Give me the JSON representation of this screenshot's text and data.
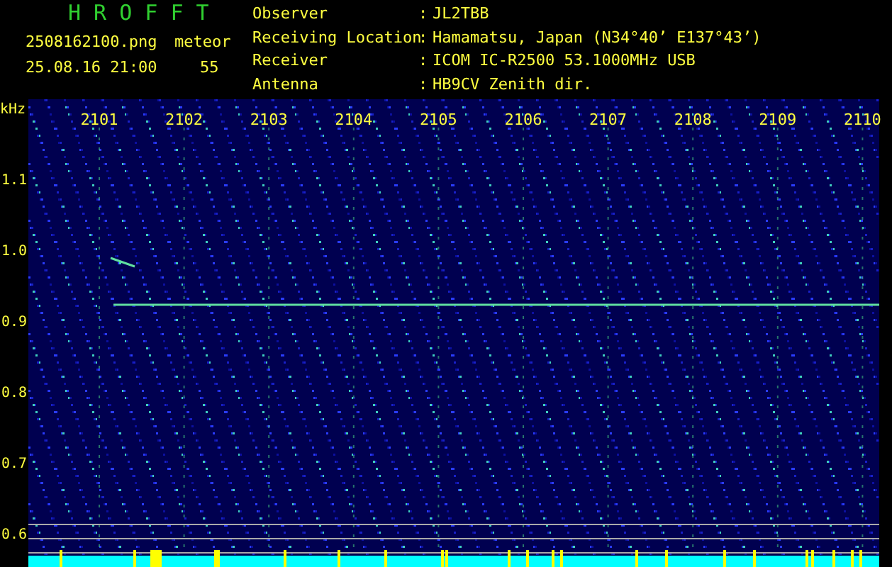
{
  "header": {
    "title": "H R O F F T",
    "filename": "2508162100.png",
    "datetime": "25.08.16 21:00",
    "count_label": "meteor",
    "count": "55",
    "info": [
      {
        "label": "Observer",
        "sep": ":",
        "value": "JL2TBB"
      },
      {
        "label": "Receiving Location",
        "sep": ":",
        "value": "Hamamatsu, Japan (N34°40’ E137°43’)"
      },
      {
        "label": "Receiver",
        "sep": ":",
        "value": "ICOM IC-R2500 53.1000MHz USB"
      },
      {
        "label": "Antenna",
        "sep": ":",
        "value": "HB9CV Zenith dir."
      }
    ]
  },
  "plot": {
    "y_unit": "kHz",
    "y_labels": [
      "1.1",
      "1.0",
      "0.9",
      "0.8",
      "0.7",
      "0.6"
    ],
    "x_labels": [
      "2101",
      "2102",
      "2103",
      "2104",
      "2105",
      "2106",
      "2107",
      "2108",
      "2109",
      "2110"
    ]
  }
}
